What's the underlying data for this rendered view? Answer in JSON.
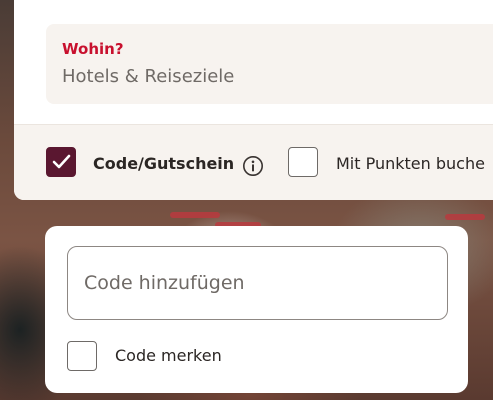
{
  "destination": {
    "label": "Wohin?",
    "placeholder": "Hotels & Reiseziele"
  },
  "options": {
    "code_voucher": {
      "label": "Code/Gutschein",
      "checked": true
    },
    "points": {
      "label": "Mit Punkten buche",
      "checked": false
    }
  },
  "code_panel": {
    "input_placeholder": "Code hinzufügen",
    "remember": {
      "label": "Code merken",
      "checked": false
    }
  },
  "colors": {
    "accent_red": "#c8102e",
    "checkbox_checked": "#5a1730",
    "panel_bg": "#f7f3ef"
  },
  "icons": [
    "checkmark-icon",
    "info-icon"
  ]
}
